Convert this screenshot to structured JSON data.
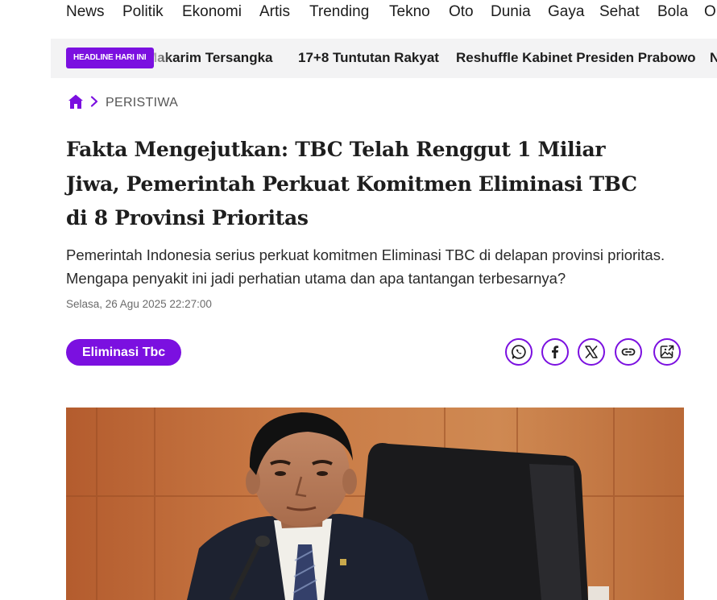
{
  "nav": {
    "items": [
      "News",
      "Politik",
      "Ekonomi",
      "Artis",
      "Trending",
      "Tekno",
      "Oto",
      "Dunia",
      "Gaya",
      "Sehat",
      "Bola",
      "O"
    ]
  },
  "headline_bar": {
    "badge": "HEADLINE HARI INI",
    "items": [
      "Makarim Tersangka",
      "17+8 Tuntutan Rakyat",
      "Reshuffle Kabinet Presiden Prabowo",
      "N"
    ]
  },
  "breadcrumb": {
    "home_icon": "home-icon",
    "separator_icon": "chevron-right-icon",
    "category": "PERISTIWA"
  },
  "article": {
    "title": "Fakta Mengejutkan: TBC Telah Renggut 1 Miliar Jiwa, Pemerintah Perkuat Komitmen Eliminasi TBC di 8 Provinsi Prioritas",
    "lede": "Pemerintah Indonesia serius perkuat komitmen Eliminasi TBC di delapan provinsi prioritas. Mengapa penyakit ini jadi perhatian utama dan apa tantangan terbesarnya?",
    "date": "Selasa, 26 Agu 2025 22:27:00",
    "tag": "Eliminasi Tbc"
  },
  "share": {
    "icons": [
      "whatsapp-icon",
      "facebook-icon",
      "x-icon",
      "link-icon",
      "image-share-icon"
    ]
  },
  "colors": {
    "accent": "#7b10e0",
    "strip_bg": "#f3f3f4"
  }
}
